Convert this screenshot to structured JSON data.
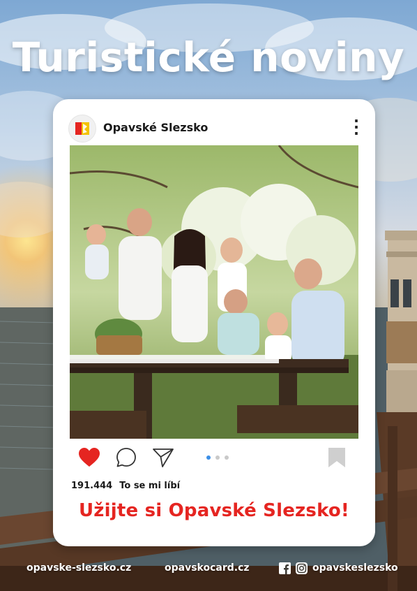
{
  "poster": {
    "title": "Turistické noviny"
  },
  "post": {
    "account_name": "Opavské Slezsko",
    "likes_count": "191.444",
    "likes_label": "To se mi líbí",
    "slogan": "Užijte si Opavské Slezsko!",
    "carousel_active_index": 0,
    "carousel_total": 3,
    "icons": [
      "heart-icon",
      "comment-icon",
      "send-icon",
      "bookmark-icon",
      "more-vertical-icon"
    ]
  },
  "footer": {
    "website_1": "opavske-slezsko.cz",
    "website_2": "opavskocard.cz",
    "social_handle": "opavskeslezsko",
    "social_icons": [
      "facebook-icon",
      "instagram-icon"
    ]
  },
  "colors": {
    "accent_red": "#e52521",
    "logo_yellow": "#f3c300",
    "heart_red": "#e52521",
    "card_bg": "#ffffff",
    "dot_active": "#3b8ee6",
    "dot_inactive": "#c9c9c9"
  }
}
